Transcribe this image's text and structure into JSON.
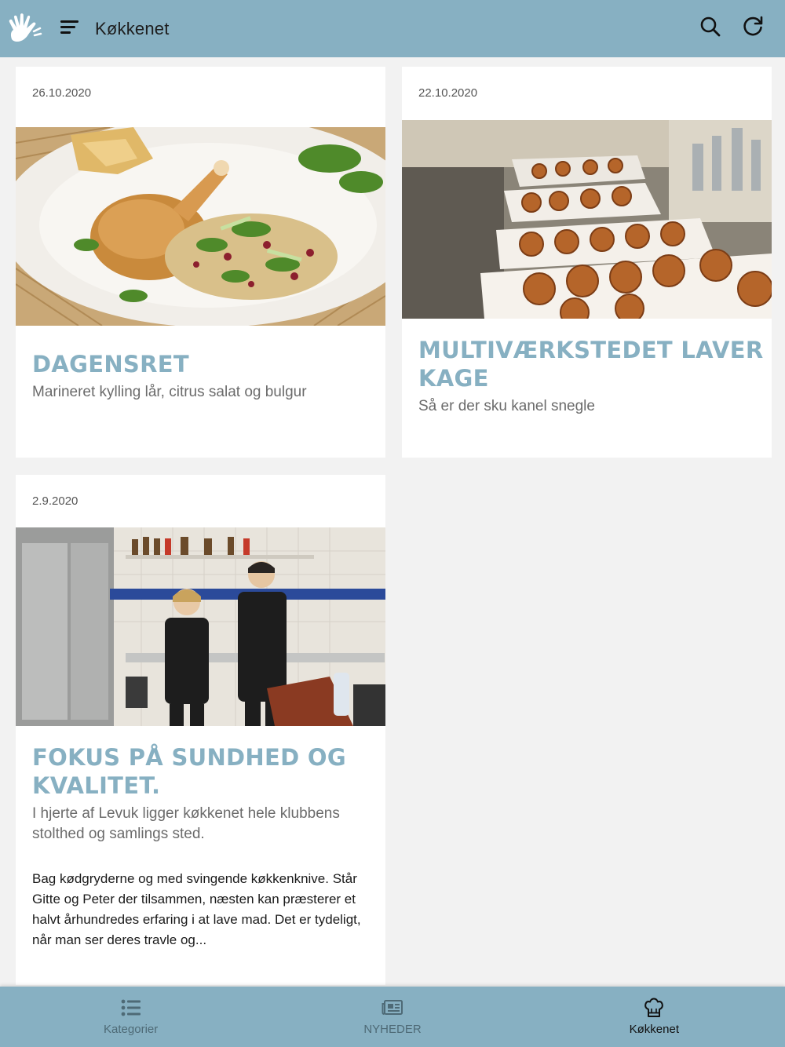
{
  "header": {
    "title": "Køkkenet",
    "menu_icon": "menu-icon",
    "logo_icon": "hand-logo-icon",
    "search_icon": "search-icon",
    "refresh_icon": "refresh-icon"
  },
  "articles": [
    {
      "date": "26.10.2020",
      "title": "DAGENSRET",
      "subtitle": "Marineret kylling lår, citrus salat og bulgur",
      "image": "chicken-salad-plate-photo"
    },
    {
      "date": "22.10.2020",
      "title": "MULTIVÆRKSTEDET LAVER KAGE",
      "subtitle": "Så er der sku kanel snegle",
      "image": "cinnamon-rolls-trays-photo"
    },
    {
      "date": "2.9.2020",
      "title": "FOKUS PÅ SUNDHED OG KVALITET.",
      "subtitle": "I hjerte af Levuk ligger køkkenet hele klubbens stolthed og samlings sted.",
      "body": "Bag kødgryderne og med svingende køkkenknive. Står Gitte og Peter der tilsammen, næsten kan præsterer et halvt århundredes erfaring i at lave mad. Det er tydeligt, når man ser deres travle og...",
      "image": "kitchen-staff-photo"
    }
  ],
  "bottom_nav": {
    "items": [
      {
        "label": "Kategorier",
        "icon": "list-icon",
        "active": false
      },
      {
        "label": "NYHEDER",
        "icon": "newspaper-icon",
        "active": false
      },
      {
        "label": "Køkkenet",
        "icon": "chef-hat-icon",
        "active": true
      }
    ]
  },
  "colors": {
    "accent": "#87b0c2",
    "background": "#f2f2f2",
    "card": "#ffffff",
    "title_text": "#87b0c2"
  }
}
